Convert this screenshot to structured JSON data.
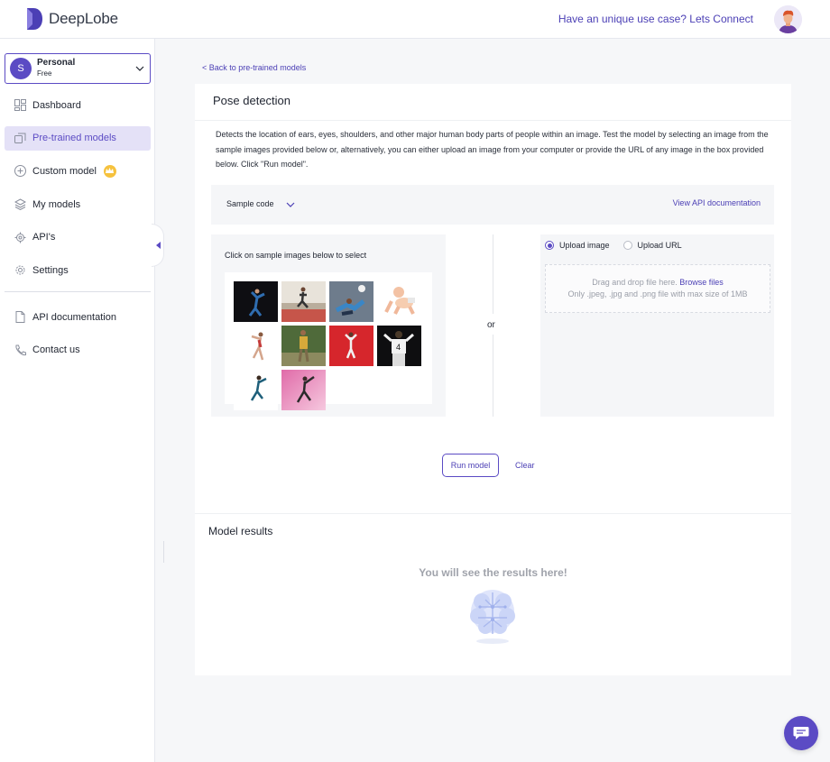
{
  "header": {
    "brand": "DeepLobe",
    "connect_link": "Have an unique use case? Lets Connect"
  },
  "workspace": {
    "initial": "S",
    "name": "Personal",
    "plan": "Free"
  },
  "sidebar": {
    "items": [
      {
        "label": "Dashboard",
        "icon": "dashboard-icon"
      },
      {
        "label": "Pre-trained models",
        "icon": "pretrained-models-icon"
      },
      {
        "label": "Custom model",
        "icon": "plus-circle-icon"
      },
      {
        "label": "My models",
        "icon": "layers-icon"
      },
      {
        "label": "API's",
        "icon": "api-gear-icon"
      },
      {
        "label": "Settings",
        "icon": "gear-icon"
      }
    ],
    "secondary": [
      {
        "label": "API documentation",
        "icon": "document-icon"
      },
      {
        "label": "Contact us",
        "icon": "phone-icon"
      }
    ]
  },
  "main": {
    "back_link": "< Back to pre-trained models",
    "title": "Pose detection",
    "description": "Detects the location of ears, eyes, shoulders, and other major human body parts of people within an image. Test the model by selecting an image from the sample images provided below or, alternatively, you can either upload an image from your computer or provide the URL of any image in the box provided below. Click \"Run model\".",
    "sample_code_label": "Sample code",
    "api_doc_link": "View API documentation",
    "samples_label": "Click on sample images below to select",
    "or_label": "or",
    "upload": {
      "option_image": "Upload image",
      "option_url": "Upload URL",
      "selected": "Upload image",
      "drop_text": "Drag and drop file here.",
      "browse_link": "Browse files",
      "hint": "Only .jpeg, .jpg and .png file with max size of 1MB"
    },
    "run_button": "Run model",
    "clear_link": "Clear",
    "results_title": "Model results",
    "results_empty": "You will see the results here!"
  },
  "colors": {
    "accent": "#5b4bc4",
    "active_bg": "#e4e1f7",
    "panel_bg": "#f5f6f8",
    "crown": "#f6c23e"
  }
}
